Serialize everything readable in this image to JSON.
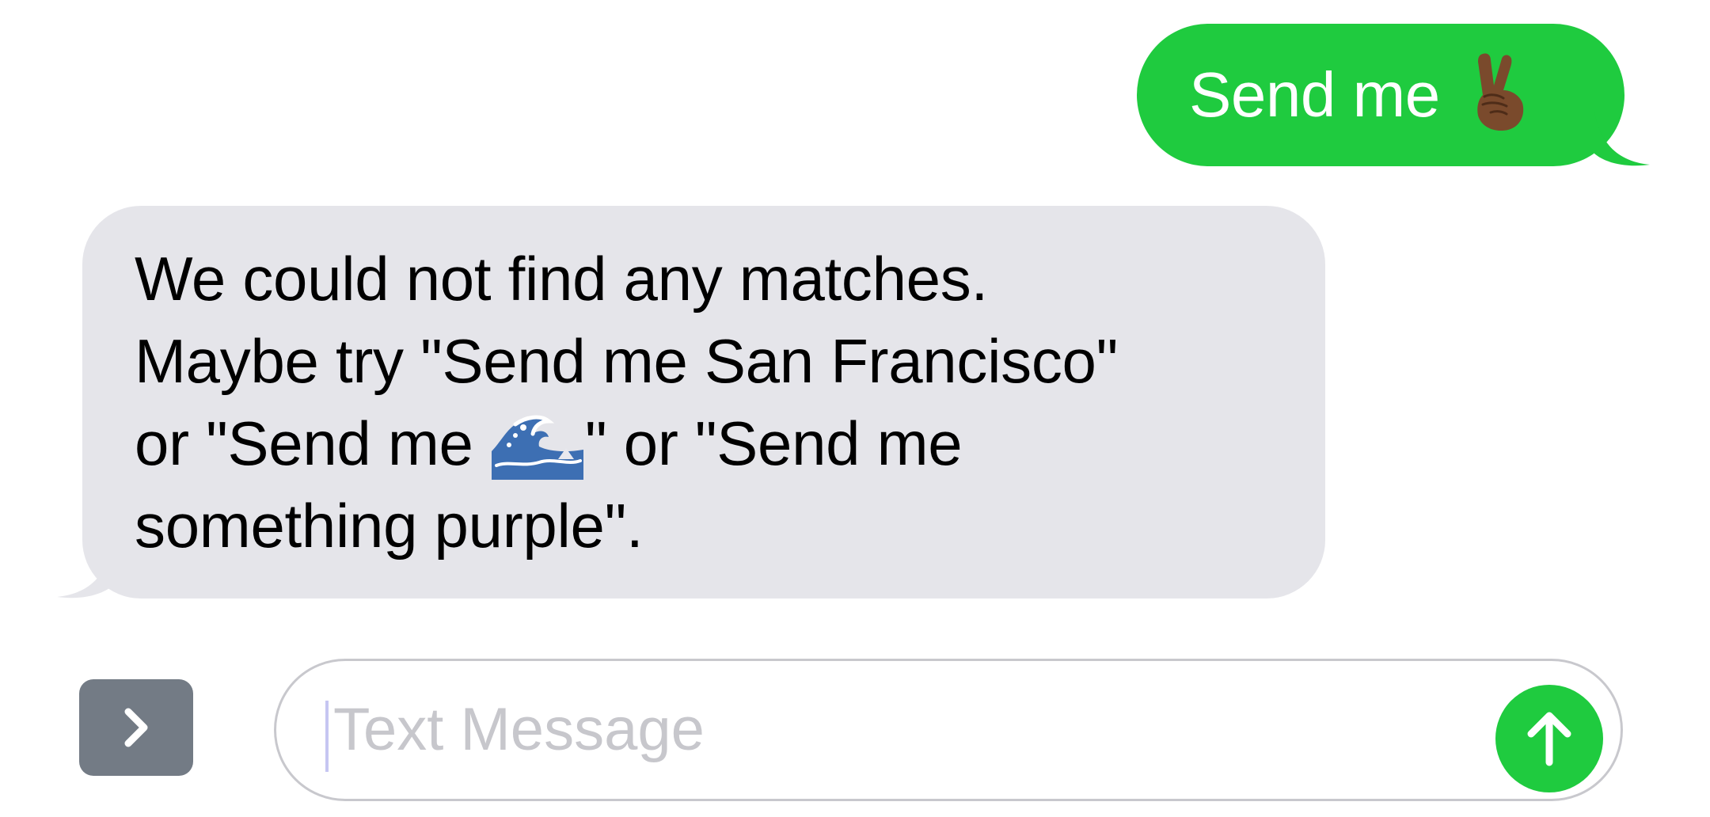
{
  "conversation": {
    "outgoing": {
      "text": "Send me",
      "emoji": "victory-hand-emoji",
      "bubble_color": "#1fcb3f",
      "text_color": "#ffffff"
    },
    "incoming": {
      "line1": "We could not find any matches.",
      "line2": "Maybe try \"Send me San Francisco\"",
      "line3_before": "or \"Send me ",
      "line3_emoji": "water-wave-emoji",
      "line3_after": "\" or \"Send me",
      "line4": "something purple\".",
      "bubble_color": "#e5e5ea",
      "text_color": "#000000"
    }
  },
  "composer": {
    "apps_button_icon": "chevron-right-icon",
    "placeholder": "Text Message",
    "send_button_icon": "arrow-up-icon",
    "send_button_color": "#1fcb3f"
  }
}
